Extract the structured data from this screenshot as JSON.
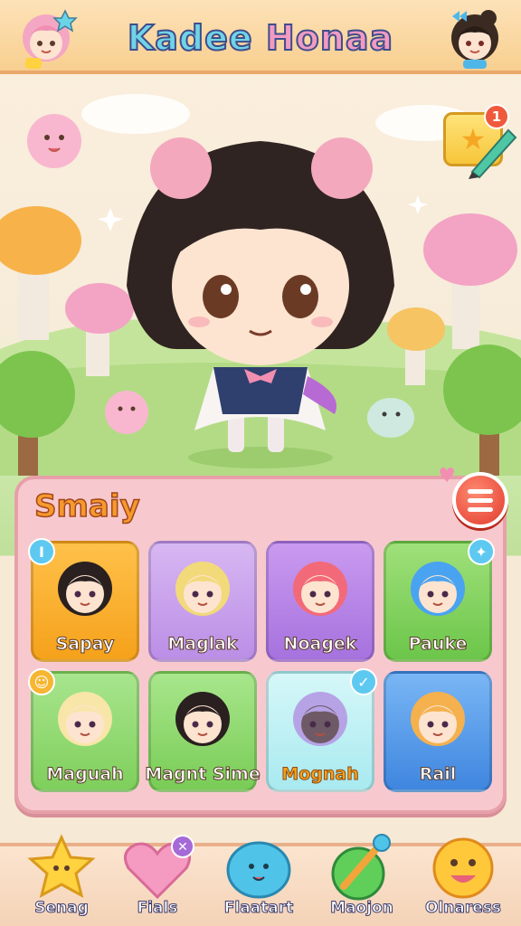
{
  "header": {
    "title_part1": "Kadee ",
    "title_part2": "Honaa"
  },
  "quest_badge": "1",
  "panel": {
    "title": "Smaiy",
    "characters": [
      {
        "name": "Sapay",
        "color": "orange",
        "hair": "#2a2020",
        "corner": "I"
      },
      {
        "name": "Maglak",
        "color": "purple",
        "hair": "#f2d97a",
        "corner": ""
      },
      {
        "name": "Noagek",
        "color": "violet",
        "hair": "#f26a7a",
        "corner": ""
      },
      {
        "name": "Pauke",
        "color": "green",
        "hair": "#4aa3f0",
        "corner": "✦"
      },
      {
        "name": "Maguah",
        "color": "lgreen",
        "hair": "#f7e6a8",
        "corner": "☺"
      },
      {
        "name": "Magnt Sime",
        "color": "green2",
        "hair": "#2a2020",
        "corner": ""
      },
      {
        "name": "Mognah",
        "color": "cyan",
        "hair": "#b6a3e6",
        "corner": "✓"
      },
      {
        "name": "Rail",
        "color": "blue",
        "hair": "#f4b14e",
        "corner": ""
      }
    ]
  },
  "nav": [
    {
      "label": "Senag",
      "icon": "star-icon"
    },
    {
      "label": "Fials",
      "icon": "heart-icon"
    },
    {
      "label": "Flaatart",
      "icon": "blob-icon"
    },
    {
      "label": "Maojon",
      "icon": "wand-icon"
    },
    {
      "label": "Olnaress",
      "icon": "smiley-icon"
    }
  ],
  "colors": {
    "accent": "#f59a2c",
    "panel": "#f7c9cf",
    "header": "#f8cf90"
  }
}
